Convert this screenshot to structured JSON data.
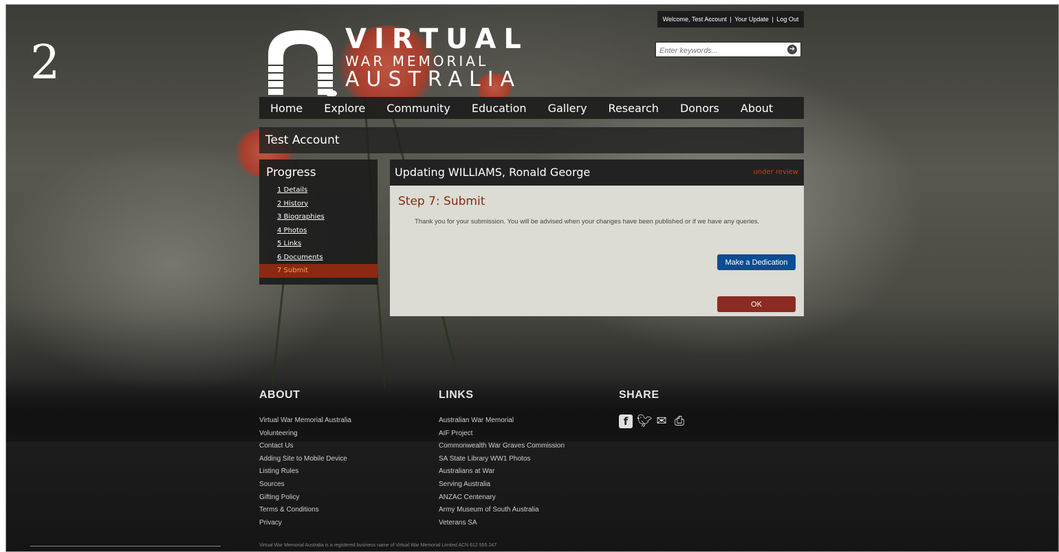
{
  "slide_number": "2",
  "userbar": {
    "welcome": "Welcome, Test Account",
    "sep1": "|",
    "your_update": "Your Update",
    "sep2": "|",
    "logout": "Log Out"
  },
  "search": {
    "placeholder": "Enter keywords..."
  },
  "logo": {
    "line1": "VIRTUAL",
    "line2": "WAR MEMORIAL",
    "line3": "AUSTRALIA"
  },
  "nav": [
    "Home",
    "Explore",
    "Community",
    "Education",
    "Gallery",
    "Research",
    "Donors",
    "About"
  ],
  "account_name": "Test Account",
  "progress": {
    "title": "Progress",
    "steps": [
      "1 Details",
      "2 History",
      "3 Biographies",
      "4 Photos",
      "5 Links",
      "6 Documents",
      "7 Submit"
    ]
  },
  "panel": {
    "heading": "Updating WILLIAMS, Ronald George",
    "status": "under review",
    "step_title": "Step 7: Submit",
    "message": "Thank you for your submission. You will be advised when your changes have been published or if we have any queries.",
    "dedication_button": "Make a Dedication",
    "ok_button": "OK"
  },
  "footer": {
    "about": {
      "title": "ABOUT",
      "items": [
        "Virtual War Memorial Australia",
        "Volunteering",
        "Contact Us",
        "Adding Site to Mobile Device",
        "Listing Rules",
        "Sources",
        "Gifting Policy",
        "Terms & Conditions",
        "Privacy"
      ]
    },
    "links": {
      "title": "LINKS",
      "items": [
        "Australian War Memorial",
        "AIF Project",
        "Commonwealth War Graves Commission",
        "SA State Library WW1 Photos",
        "Australians at War",
        "Serving Australia",
        "ANZAC Centenary",
        "Army Museum of South Australia",
        "Veterans SA"
      ]
    },
    "share": {
      "title": "SHARE"
    },
    "legal": "Virtual War Memorial Australia is a registered business name of Virtual War Memorial Limited ACN 612 555 247"
  }
}
